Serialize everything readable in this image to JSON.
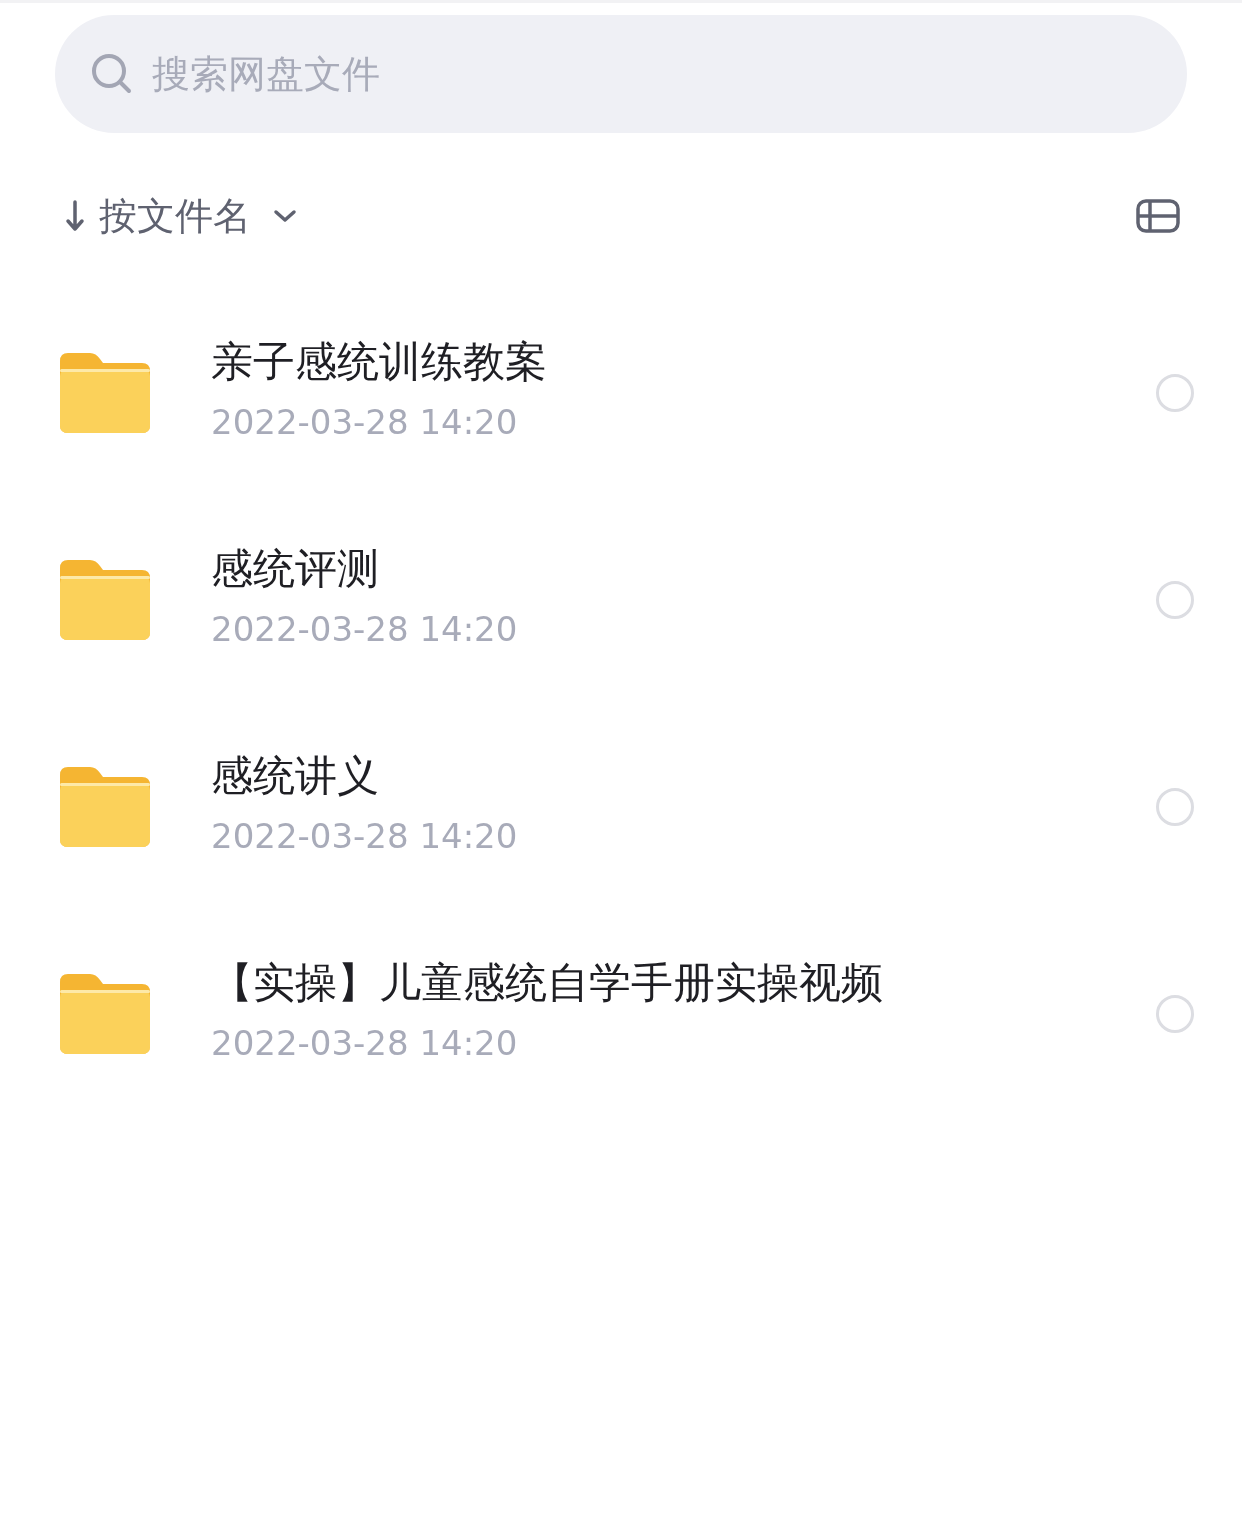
{
  "search": {
    "placeholder": "搜索网盘文件"
  },
  "sort": {
    "label": "按文件名"
  },
  "files": [
    {
      "kind": "folder",
      "name": "亲子感统训练教案",
      "date": "2022-03-28 14:20",
      "selected": false
    },
    {
      "kind": "folder",
      "name": "感统评测",
      "date": "2022-03-28 14:20",
      "selected": false
    },
    {
      "kind": "folder",
      "name": "感统讲义",
      "date": "2022-03-28 14:20",
      "selected": false
    },
    {
      "kind": "folder",
      "name": "【实操】儿童感统自学手册实操视频",
      "date": "2022-03-28 14:20",
      "selected": false
    }
  ]
}
